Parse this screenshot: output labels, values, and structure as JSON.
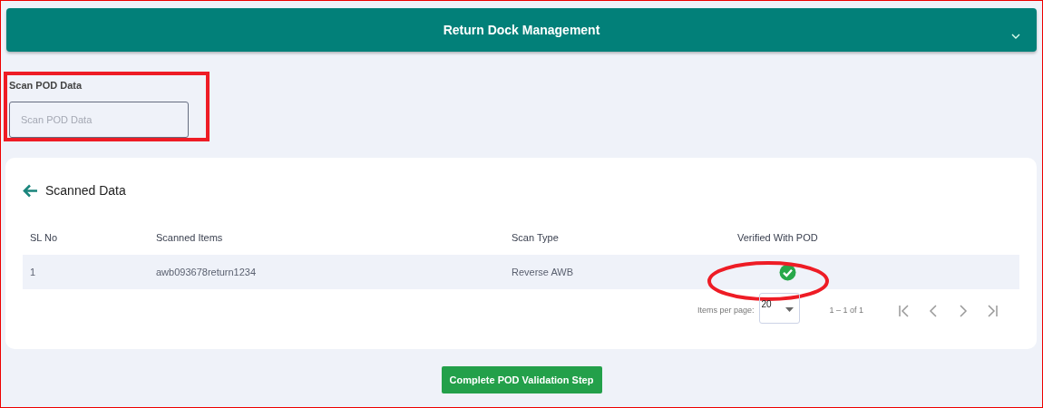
{
  "header": {
    "title": "Return Dock Management",
    "expanded": false
  },
  "scan_field": {
    "label": "Scan POD Data",
    "placeholder": "Scan POD Data"
  },
  "scanned_card": {
    "title": "Scanned Data",
    "table": {
      "columns": [
        "SL No",
        "Scanned Items",
        "Scan Type",
        "Verified With POD"
      ],
      "rows": [
        {
          "cells": [
            "1",
            "awb093678return1234",
            "Reverse AWB"
          ],
          "verified": true
        }
      ]
    },
    "paginator": {
      "label": "Items per page:",
      "page_size": "20",
      "range": "1 – 1 of 1"
    }
  },
  "action_button": "Complete POD Validation Step",
  "annotations": [
    {
      "kind": "box"
    },
    {
      "kind": "ellipse"
    }
  ]
}
